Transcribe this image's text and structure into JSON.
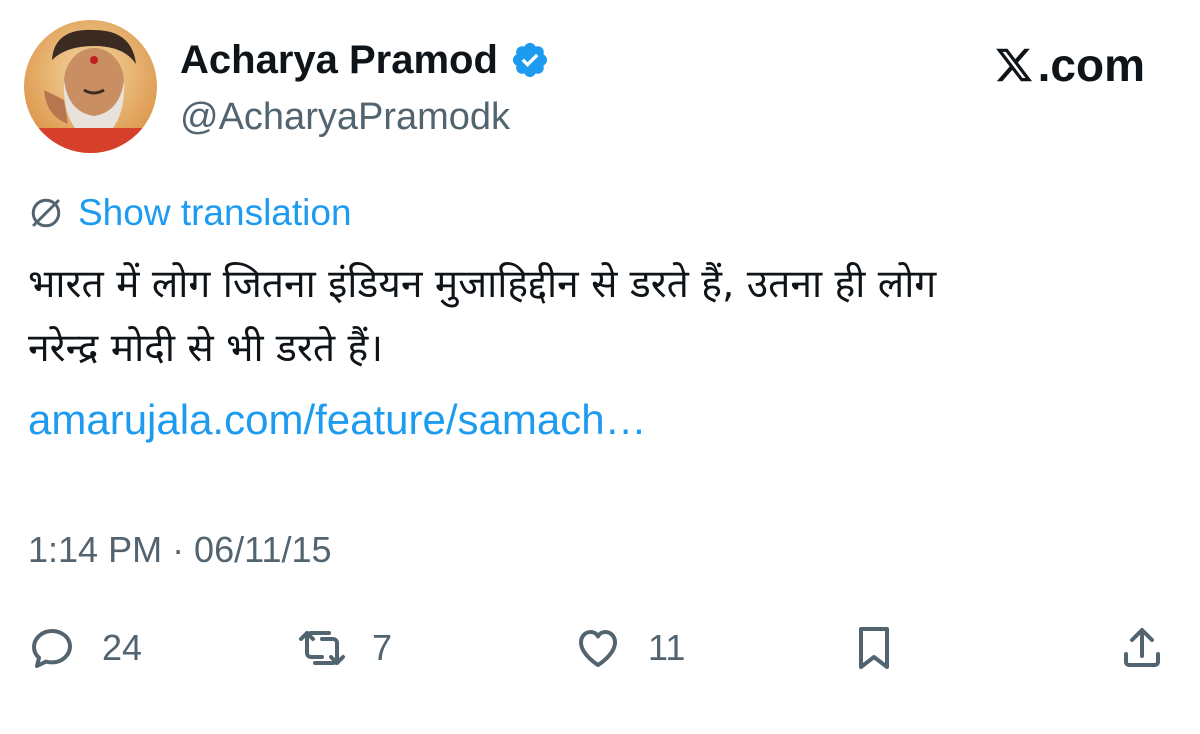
{
  "author": {
    "display_name": "Acharya Pramod",
    "handle": "@AcharyaPramodk",
    "verified": true,
    "avatar": "avatar-photo"
  },
  "brand": {
    "label": ".com",
    "icon": "x-logo-icon"
  },
  "translation": {
    "label": "Show translation",
    "icon": "globe-translate-icon"
  },
  "tweet": {
    "text_line1": "भारत में लोग जितना इंडियन मुजाहिद्दीन से डरते हैं, उतना ही लोग",
    "text_line2": "नरेन्द्र मोदी से भी डरते हैं।",
    "link": "amarujala.com/feature/samach…",
    "timestamp": "1:14 PM · 06/11/15"
  },
  "actions": {
    "reply": {
      "icon": "reply-icon",
      "count": "24"
    },
    "retweet": {
      "icon": "retweet-icon",
      "count": "7"
    },
    "like": {
      "icon": "heart-icon",
      "count": "11"
    },
    "bookmark": {
      "icon": "bookmark-icon"
    },
    "share": {
      "icon": "share-icon"
    }
  },
  "colors": {
    "accent": "#1d9bf0",
    "text": "#0f1419",
    "secondary": "#536471"
  }
}
